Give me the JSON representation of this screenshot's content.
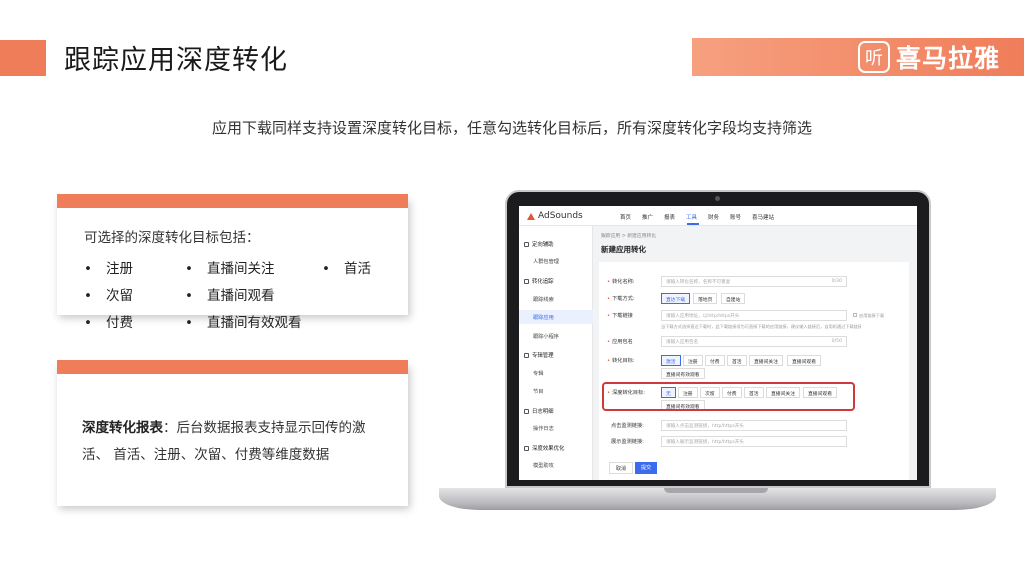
{
  "header": {
    "title": "跟踪应用深度转化",
    "logo_mark": "听",
    "logo_text": "喜马拉雅"
  },
  "subtitle": "应用下载同样支持设置深度转化目标，任意勾选转化目标后，所有深度转化字段均支持筛选",
  "card1": {
    "title": "可选择的深度转化目标包括：",
    "items": [
      "注册",
      "直播间关注",
      "首活",
      "次留",
      "直播间观看",
      "付费",
      "直播间有效观看"
    ]
  },
  "card2": {
    "bold": "深度转化报表",
    "text": "：后台数据报表支持显示回传的激活、 首活、注册、次留、付费等维度数据"
  },
  "screen": {
    "brand": "AdSounds",
    "nav": [
      "首页",
      "推广",
      "报表",
      "工具",
      "财务",
      "账号",
      "喜马建站"
    ],
    "nav_active": "工具",
    "sidebar": {
      "g1": "定向辅助",
      "i1": "人群包管理",
      "g2": "转化追踪",
      "i2": "跟踪线索",
      "i3": "跟踪应用",
      "i4": "跟踪小程序",
      "g3": "专辑管理",
      "i5": "专辑",
      "i6": "节目",
      "g4": "日志明细",
      "i7": "操作日志",
      "g5": "深度效果优化",
      "i8": "模型助攻"
    },
    "breadcrumb": "跟踪应用  >  新建应用转化",
    "page_title": "新建应用转化",
    "form": {
      "name_label": "转化名称:",
      "name_placeholder": "请输入转化名称，名称不可重复",
      "name_count": "0/30",
      "method_label": "下载方式:",
      "methods": [
        "直达下载",
        "落地页",
        "自建站"
      ],
      "link_label": "下载链接",
      "link_placeholder": "请输入应用地址，以http/https开头",
      "link_hint": "当下载方式选择直达下载时，此下载链接须为可直接下载的应用链接，建议输入链接后，自用机通过下载链接进行下载后再确认。",
      "link_check": "启用链接下载",
      "pkg_label": "应用包名",
      "pkg_placeholder": "请输入应用包名",
      "pkg_count": "0/50",
      "target_label": "转化目标:",
      "targets": [
        "激活",
        "注册",
        "付费",
        "首活",
        "直播间关注",
        "直播间观看",
        "直播间有效观看"
      ],
      "deep_label": "深度转化目标:",
      "deep_targets": [
        "无",
        "注册",
        "次留",
        "付费",
        "首活",
        "直播间关注",
        "直播间观看",
        "直播间有效观看"
      ],
      "click_label": "点击监测链接:",
      "click_placeholder": "请输入点击监测链接，http/https开头",
      "show_label": "展示监测链接:",
      "show_placeholder": "请输入展示监测链接，http/https开头",
      "cancel": "取消",
      "submit": "提交"
    }
  },
  "colors": {
    "accent": "#f07d5a",
    "primary_blue": "#3b6cf0",
    "highlight_red": "#d0393b"
  }
}
